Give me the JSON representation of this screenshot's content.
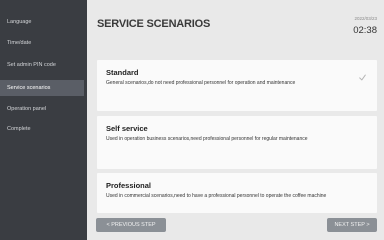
{
  "sidebar": {
    "items": [
      {
        "label": "Language"
      },
      {
        "label": "Time/date"
      },
      {
        "label": "Set admin PIN code"
      },
      {
        "label": "Service scenarios",
        "active": true
      },
      {
        "label": "Operation panel"
      },
      {
        "label": "Complete"
      }
    ]
  },
  "header": {
    "title": "SERVICE SCENARIOS",
    "date": "2022/03/23",
    "time": "02:38"
  },
  "scenarios": [
    {
      "name": "Standard",
      "description": "General scenarios,do not need professional personnel for operation and maintenance",
      "selected": true
    },
    {
      "name": "Self service",
      "description": "Used in operation business scenarios,need professional personnel for regular maintenance"
    },
    {
      "name": "Professional",
      "description": "Used in commercial scenarios,need to have a professional personnel to operate the coffee machine"
    }
  ],
  "footer": {
    "prev_label": "< PREVIOUS STEP",
    "next_label": "NEXT STEP >"
  },
  "colors": {
    "sidebar_bg": "#3a3d42",
    "sidebar_active": "#5a5e66",
    "button_bg": "#8b9096",
    "page_bg": "#e9e9e9"
  }
}
